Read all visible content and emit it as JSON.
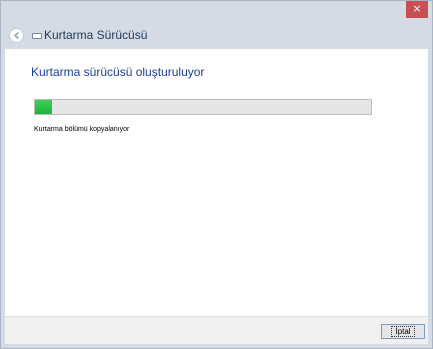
{
  "window": {
    "close_symbol": "×",
    "nav_title": "Kurtarma Sürücüsü"
  },
  "main": {
    "heading": "Kurtarma sürücüsü oluşturuluyor",
    "progress": 0.05,
    "status": "Kurtarma bölümü kopyalanıyor"
  },
  "footer": {
    "cancel_label": "İptal"
  },
  "icons": {
    "back": "back-arrow-icon",
    "drive": "drive-icon",
    "close": "close-icon"
  },
  "colors": {
    "accent_text": "#1a3e9c",
    "progress_fill": "#2cc14a",
    "close_button": "#c75050",
    "chrome": "#d4dbe4"
  }
}
